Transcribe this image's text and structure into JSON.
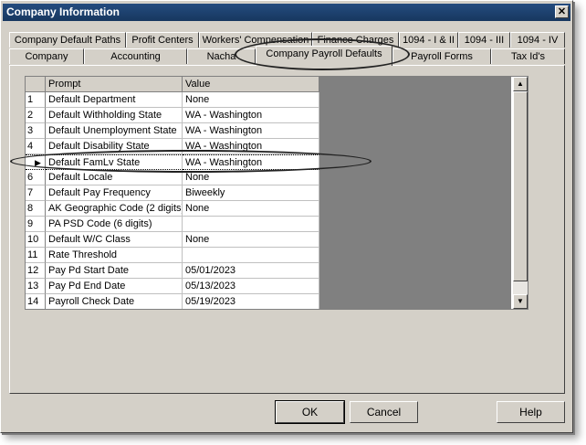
{
  "window": {
    "title": "Company Information",
    "close_glyph": "✕"
  },
  "tabs_row1": [
    {
      "label": "Company Default Paths"
    },
    {
      "label": "Profit Centers"
    },
    {
      "label": "Workers' Compensation"
    },
    {
      "label": "Finance Charges"
    },
    {
      "label": "1094 - I & II"
    },
    {
      "label": "1094 - III"
    },
    {
      "label": "1094 - IV"
    }
  ],
  "tabs_row2": [
    {
      "label": "Company"
    },
    {
      "label": "Accounting"
    },
    {
      "label": "Nacha"
    },
    {
      "label": "Company Payroll Defaults"
    },
    {
      "label": "Payroll Forms"
    },
    {
      "label": "Tax Id's"
    }
  ],
  "grid": {
    "columns": [
      "Prompt",
      "Value"
    ],
    "row_indicator": "▶",
    "rows": [
      {
        "num": "1",
        "prompt": "Default Department",
        "value": "None"
      },
      {
        "num": "2",
        "prompt": "Default Withholding State",
        "value": "WA - Washington"
      },
      {
        "num": "3",
        "prompt": "Default Unemployment State",
        "value": "WA - Washington"
      },
      {
        "num": "4",
        "prompt": "Default Disability State",
        "value": "WA - Washington"
      },
      {
        "num": "",
        "prompt": "Default FamLv State",
        "value": "WA - Washington"
      },
      {
        "num": "6",
        "prompt": "Default Locale",
        "value": "None"
      },
      {
        "num": "7",
        "prompt": "Default Pay Frequency",
        "value": "Biweekly"
      },
      {
        "num": "8",
        "prompt": "AK Geographic Code (2 digits)",
        "value": "None"
      },
      {
        "num": "9",
        "prompt": "PA PSD Code (6 digits)",
        "value": ""
      },
      {
        "num": "10",
        "prompt": "Default W/C Class",
        "value": "None"
      },
      {
        "num": "11",
        "prompt": "Rate Threshold",
        "value": ""
      },
      {
        "num": "12",
        "prompt": "Pay Pd Start Date",
        "value": "05/01/2023"
      },
      {
        "num": "13",
        "prompt": "Pay Pd End Date",
        "value": "05/13/2023"
      },
      {
        "num": "14",
        "prompt": "Payroll Check Date",
        "value": "05/19/2023"
      }
    ]
  },
  "buttons": {
    "ok": "OK",
    "cancel": "Cancel",
    "help": "Help"
  },
  "colors": {
    "title_bar": "#1f4370",
    "window_bg": "#d4d0c8",
    "grid_gray": "#808080"
  },
  "icons": {
    "scroll_up": "▲",
    "scroll_down": "▼"
  }
}
